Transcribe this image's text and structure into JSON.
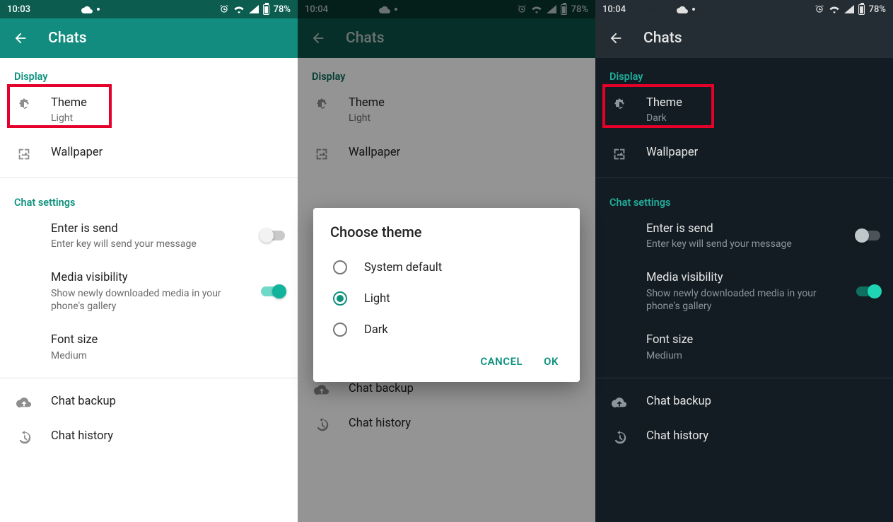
{
  "statusbar": {
    "battery": "78%"
  },
  "screens": [
    {
      "time": "10:03",
      "variant": "light",
      "theme_value": "Light",
      "highlight": true,
      "dialog": false
    },
    {
      "time": "10:04",
      "variant": "dim",
      "theme_value": "Light",
      "highlight": false,
      "dialog": true
    },
    {
      "time": "10:04",
      "variant": "dark",
      "theme_value": "Dark",
      "highlight": true,
      "dialog": false
    }
  ],
  "appbar": {
    "title": "Chats"
  },
  "sections": {
    "display": "Display",
    "chat_settings": "Chat settings"
  },
  "items": {
    "theme": {
      "title": "Theme"
    },
    "wallpaper": {
      "title": "Wallpaper"
    },
    "enter_is_send": {
      "title": "Enter is send",
      "sub": "Enter key will send your message",
      "on": false
    },
    "media_visibility": {
      "title": "Media visibility",
      "sub": "Show newly downloaded media in your phone's gallery",
      "on": true
    },
    "font_size": {
      "title": "Font size",
      "sub": "Medium"
    },
    "chat_backup": {
      "title": "Chat backup"
    },
    "chat_history": {
      "title": "Chat history"
    }
  },
  "dialog": {
    "title": "Choose theme",
    "options": [
      "System default",
      "Light",
      "Dark"
    ],
    "selected_index": 1,
    "cancel": "CANCEL",
    "ok": "OK"
  }
}
